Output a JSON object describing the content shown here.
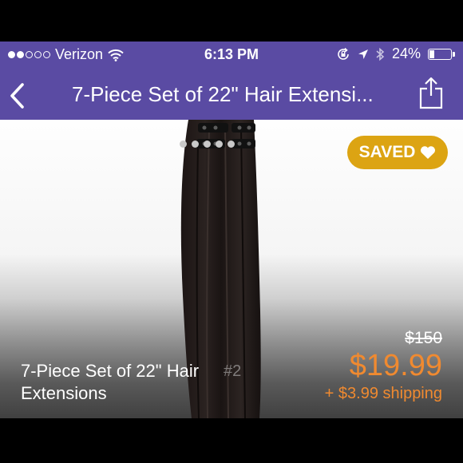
{
  "status_bar": {
    "carrier": "Verizon",
    "time": "6:13 PM",
    "battery": "24%",
    "signal_bars": 5,
    "signal_filled": 2
  },
  "nav": {
    "title": "7-Piece Set of 22\" Hair Extensi...",
    "back_icon": "chevron-left-icon",
    "share_icon": "share-icon"
  },
  "listing": {
    "saved_label": "SAVED",
    "title": "7-Piece Set of 22\" Hair Extensions",
    "watermark": "#2",
    "original_price": "$150",
    "price": "$19.99",
    "shipping": "+ $3.99 shipping"
  },
  "colors": {
    "nav_bar": "#5a4ba3",
    "saved_badge": "#dca413",
    "price": "#f08a30"
  }
}
